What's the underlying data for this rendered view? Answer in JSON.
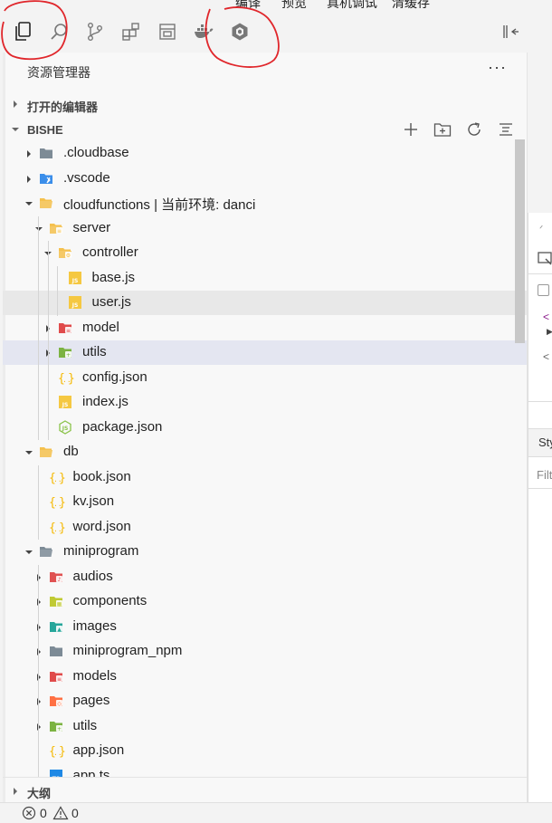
{
  "menubar": {
    "items": [
      "编译",
      "预览",
      "真机调试",
      "清缓存"
    ]
  },
  "activity_bar": {
    "icons": [
      "files-icon",
      "search-icon",
      "source-control-icon",
      "extensions-icon",
      "panel-icon",
      "docker-icon",
      "cloud-icon"
    ],
    "collapse_icon": "collapse-sidebar-icon"
  },
  "explorer": {
    "title": "资源管理器",
    "more": "···",
    "open_editors": "打开的编辑器",
    "project": "BISHE",
    "outline": "大纲"
  },
  "tree": [
    {
      "name": ".cloudbase",
      "depth": 0,
      "type": "folder",
      "expanded": false,
      "icon": "folder-gray-icon",
      "color": "#7d8b96"
    },
    {
      "name": ".vscode",
      "depth": 0,
      "type": "folder",
      "expanded": false,
      "icon": "vscode-folder-icon",
      "color": "#3b8eea"
    },
    {
      "name": "cloudfunctions | 当前环境: danci",
      "depth": 0,
      "type": "folder",
      "expanded": true,
      "icon": "folder-open-icon",
      "color": "#f5c14e"
    },
    {
      "name": "server",
      "depth": 1,
      "type": "folder",
      "expanded": true,
      "icon": "server-folder-icon",
      "color": "#f5c14e"
    },
    {
      "name": "controller",
      "depth": 2,
      "type": "folder",
      "expanded": true,
      "icon": "controller-folder-icon",
      "color": "#f5c14e"
    },
    {
      "name": "base.js",
      "depth": 3,
      "type": "js",
      "icon": "js-file-icon",
      "color": "#f5c842"
    },
    {
      "name": "user.js",
      "depth": 3,
      "type": "js",
      "icon": "js-file-icon",
      "color": "#f5c842",
      "state": "hover"
    },
    {
      "name": "model",
      "depth": 2,
      "type": "folder",
      "expanded": false,
      "icon": "model-folder-icon",
      "color": "#e04b4b"
    },
    {
      "name": "utils",
      "depth": 2,
      "type": "folder",
      "expanded": false,
      "icon": "utils-folder-icon",
      "color": "#7cb342",
      "state": "selected"
    },
    {
      "name": "config.json",
      "depth": 2,
      "type": "json",
      "icon": "json-file-icon",
      "color": "#f5b800"
    },
    {
      "name": "index.js",
      "depth": 2,
      "type": "js",
      "icon": "js-file-icon",
      "color": "#f5c842"
    },
    {
      "name": "package.json",
      "depth": 2,
      "type": "node",
      "icon": "nodejs-file-icon",
      "color": "#8bc34a"
    },
    {
      "name": "db",
      "depth": 0,
      "type": "folder",
      "expanded": true,
      "icon": "folder-open-icon",
      "color": "#f5c14e"
    },
    {
      "name": "book.json",
      "depth": 1,
      "type": "json",
      "icon": "json-file-icon",
      "color": "#f5b800"
    },
    {
      "name": "kv.json",
      "depth": 1,
      "type": "json",
      "icon": "json-file-icon",
      "color": "#f5b800"
    },
    {
      "name": "word.json",
      "depth": 1,
      "type": "json",
      "icon": "json-file-icon",
      "color": "#f5b800"
    },
    {
      "name": "miniprogram",
      "depth": 0,
      "type": "folder",
      "expanded": true,
      "icon": "folder-open-gray-icon",
      "color": "#7d8b96"
    },
    {
      "name": "audios",
      "depth": 1,
      "type": "folder",
      "expanded": false,
      "icon": "audio-folder-icon",
      "color": "#e05252"
    },
    {
      "name": "components",
      "depth": 1,
      "type": "folder",
      "expanded": false,
      "icon": "components-folder-icon",
      "color": "#c0ca33"
    },
    {
      "name": "images",
      "depth": 1,
      "type": "folder",
      "expanded": false,
      "icon": "images-folder-icon",
      "color": "#26a69a"
    },
    {
      "name": "miniprogram_npm",
      "depth": 1,
      "type": "folder",
      "expanded": false,
      "icon": "folder-gray-icon",
      "color": "#7d8b96"
    },
    {
      "name": "models",
      "depth": 1,
      "type": "folder",
      "expanded": false,
      "icon": "models-folder-icon",
      "color": "#e04b4b"
    },
    {
      "name": "pages",
      "depth": 1,
      "type": "folder",
      "expanded": false,
      "icon": "pages-folder-icon",
      "color": "#ff7043"
    },
    {
      "name": "utils",
      "depth": 1,
      "type": "folder",
      "expanded": false,
      "icon": "utils-folder-icon",
      "color": "#7cb342"
    },
    {
      "name": "app.json",
      "depth": 1,
      "type": "json",
      "icon": "json-file-icon",
      "color": "#f5b800"
    },
    {
      "name": "app.ts",
      "depth": 1,
      "type": "ts",
      "icon": "ts-file-icon",
      "color": "#1e88e5"
    }
  ],
  "statusbar": {
    "errors": "0",
    "warnings": "0"
  },
  "right_pane": {
    "tab_label": "Sty",
    "filter_placeholder": "Filt"
  },
  "colors": {
    "annotation": "#e0262b",
    "selection": "#e4e6f1",
    "hover": "#e8e8e8"
  }
}
